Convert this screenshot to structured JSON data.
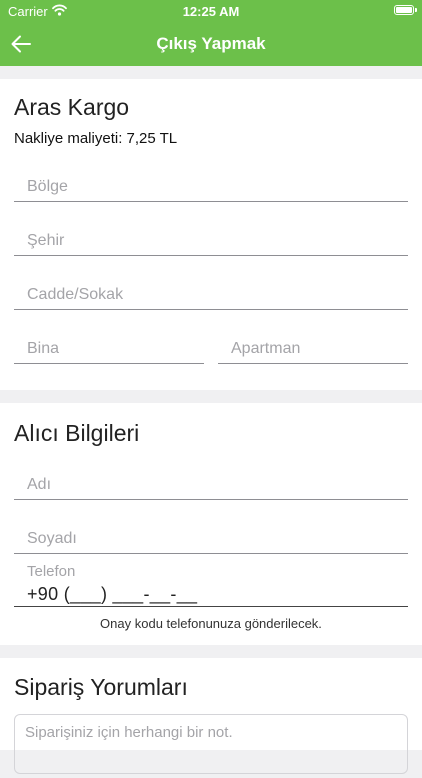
{
  "status_bar": {
    "carrier": "Carrier",
    "time": "12:25 AM"
  },
  "nav": {
    "title": "Çıkış Yapmak"
  },
  "shipping": {
    "title": "Aras Kargo",
    "cost": "Nakliye maliyeti: 7,25 TL",
    "region_placeholder": "Bölge",
    "city_placeholder": "Şehir",
    "street_placeholder": "Cadde/Sokak",
    "building_placeholder": "Bina",
    "apartment_placeholder": "Apartman"
  },
  "recipient": {
    "title": "Alıcı Bilgileri",
    "first_name_placeholder": "Adı",
    "last_name_placeholder": "Soyadı",
    "phone_label": "Telefon",
    "phone_value": "+90 (___) ___-__-__",
    "hint": "Onay kodu telefonunuza gönderilecek."
  },
  "comments": {
    "title": "Sipariş Yorumları",
    "note_placeholder": "Siparişiniz için herhangi bir not."
  },
  "colors": {
    "nav_bg": "#6cc04a",
    "page_bg": "#f0f0f2"
  },
  "icons": {
    "back": "arrow-left-icon",
    "wifi": "wifi-icon",
    "battery": "battery-icon"
  }
}
